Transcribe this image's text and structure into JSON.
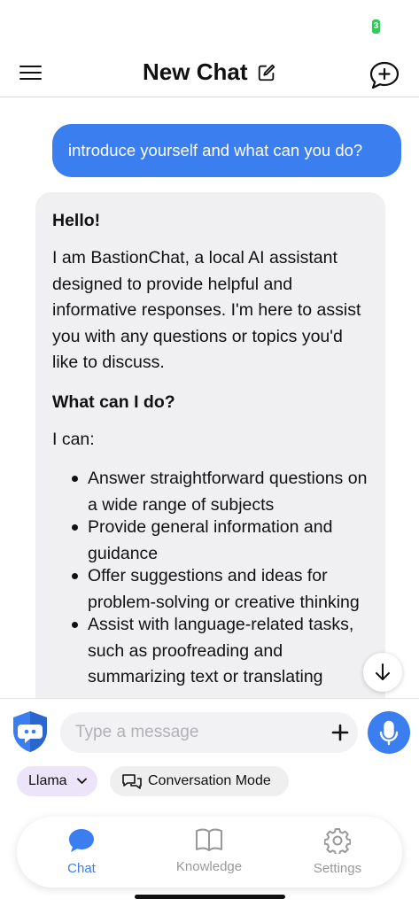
{
  "status_bar": {
    "battery": "3"
  },
  "header": {
    "title": "New Chat"
  },
  "chat": {
    "user_message": "introduce yourself and what can you do?",
    "assistant": {
      "greeting": "Hello!",
      "intro": "I am BastionChat, a local AI assistant designed to provide helpful and informative responses. I'm here to assist you with any questions or topics you'd like to discuss.",
      "section_heading": "What can I do?",
      "lead": "I can:",
      "items": [
        "Answer straightforward questions on a wide range of subjects",
        "Provide general information and guidance",
        "Offer suggestions and ideas for problem-solving or creative thinking",
        "Assist with language-related tasks, such as proofreading and summarizing text or translating"
      ]
    }
  },
  "input": {
    "placeholder": "Type a message"
  },
  "chips": {
    "model": "Llama",
    "mode": "Conversation Mode"
  },
  "nav": {
    "chat": "Chat",
    "knowledge": "Knowledge",
    "settings": "Settings"
  },
  "colors": {
    "accent": "#3a7ef0",
    "battery": "#34c759",
    "model_chip": "#ece4f8"
  }
}
